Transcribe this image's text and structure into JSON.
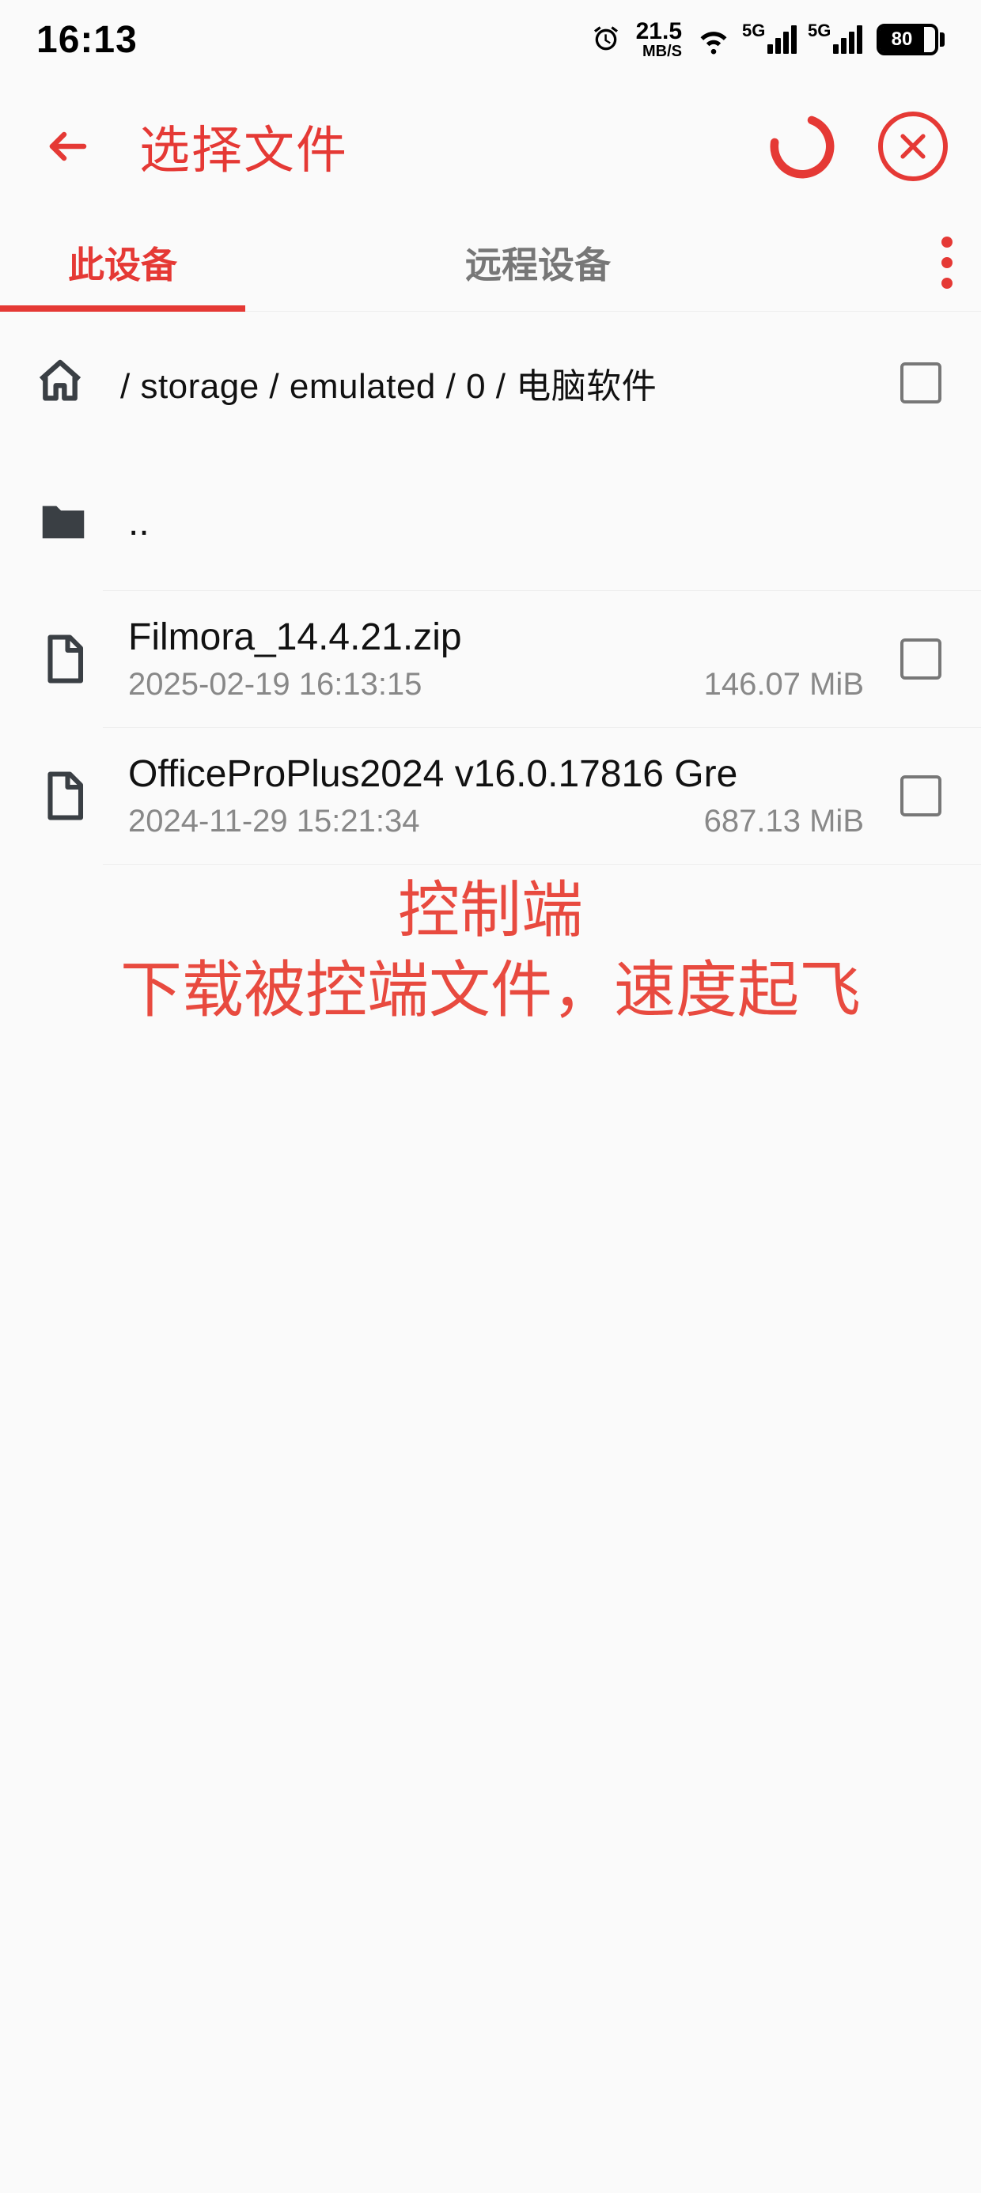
{
  "status": {
    "time": "16:13",
    "net_speed_top": "21.5",
    "net_speed_bot": "MB/S",
    "sig1_label": "5G",
    "sig2_label": "5G",
    "battery_pct": "80"
  },
  "toolbar": {
    "title": "选择文件"
  },
  "tabs": {
    "local": "此设备",
    "remote": "远程设备"
  },
  "path": {
    "breadcrumb": "/ storage / emulated / 0 / 电脑软件"
  },
  "items": [
    {
      "type": "up",
      "name": ".."
    },
    {
      "type": "file",
      "name": "Filmora_14.4.21.zip",
      "date": "2025-02-19 16:13:15",
      "size": "146.07 MiB"
    },
    {
      "type": "file",
      "name": "OfficeProPlus2024 v16.0.17816 Gre",
      "date": "2024-11-29 15:21:34",
      "size": "687.13 MiB"
    }
  ],
  "overlay": {
    "line1": "控制端",
    "line2": "下载被控端文件，速度起飞"
  },
  "colors": {
    "accent": "#e53935",
    "muted": "#888"
  }
}
